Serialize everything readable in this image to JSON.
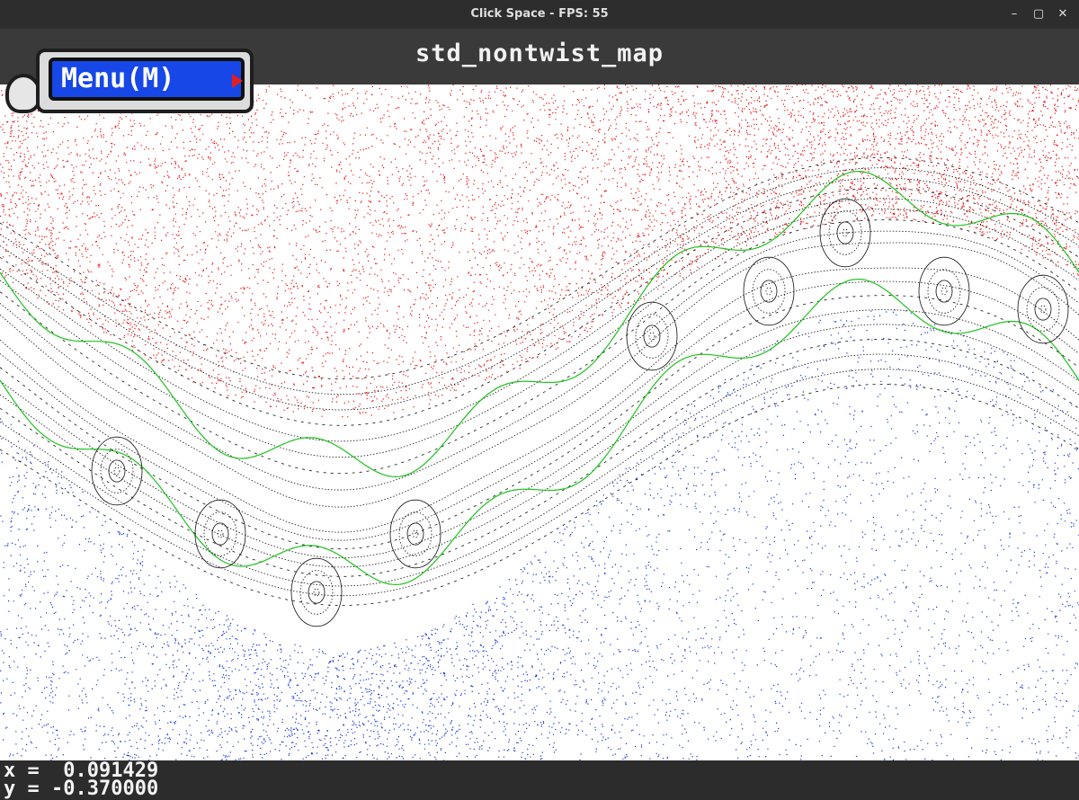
{
  "window": {
    "title": "Click Space - FPS: 55",
    "controls": {
      "minimize": "–",
      "maximize": "▢",
      "close": "✕"
    }
  },
  "header": {
    "map_name": "std_nontwist_map",
    "menu_label": "Menu(M)"
  },
  "readout": {
    "x_label": "x",
    "y_label": "y",
    "equals": "=",
    "x_value": "0.091429",
    "y_value": "-0.370000"
  },
  "colors": {
    "upper_chaos": "#e81010",
    "lower_chaos": "#1433d8",
    "separatrix": "#1fc11f",
    "orbits": "#111111",
    "plot_background": "#ffffff",
    "menu_button": "#1747e6"
  }
}
